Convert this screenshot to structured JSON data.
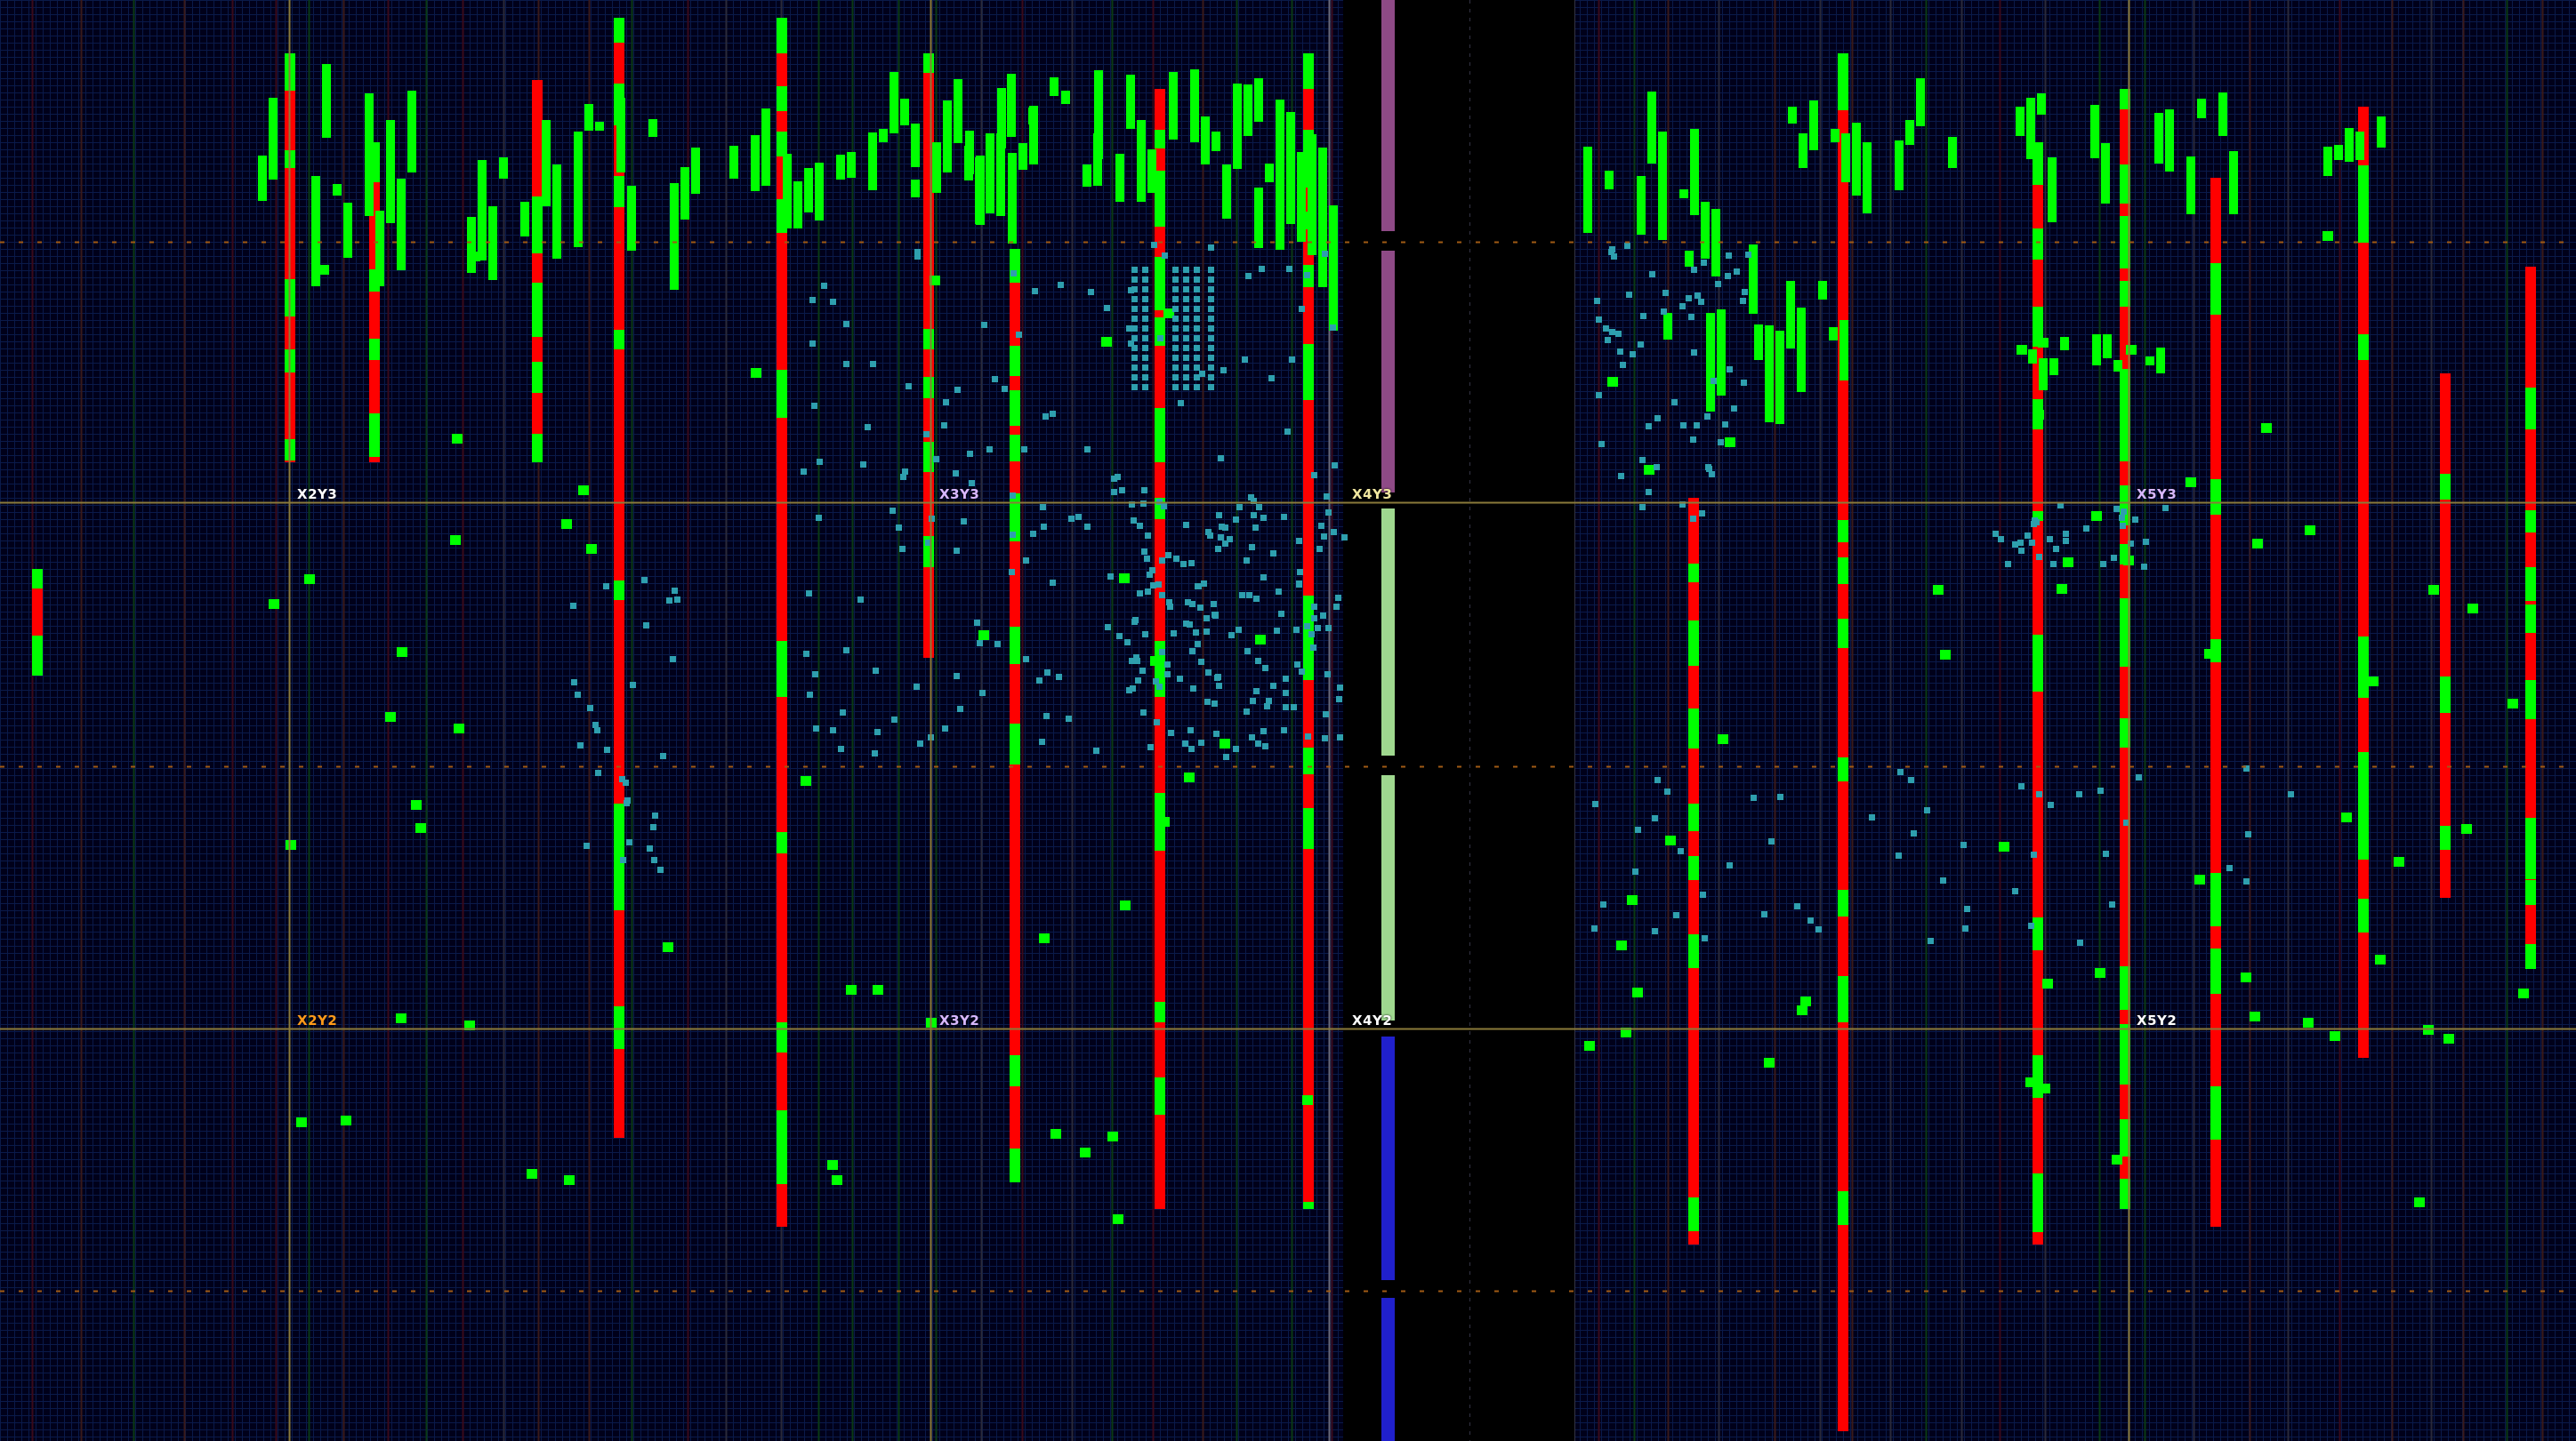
{
  "view": {
    "title": "",
    "colors": {
      "background": "#00001a",
      "grid_minor": "#0a1a4a",
      "grid_major": "#14245e",
      "region_line_gold": "#8a7a3a",
      "region_line_orange": "#a05a14",
      "placed_logic": "#00ff00",
      "critical_column": "#ff0000",
      "placed_ff": "#2e9fae",
      "io_purple": "#8e4a86",
      "io_light_green": "#9fd88f",
      "io_blue": "#2020cc",
      "label_white": "#ffffff",
      "label_orange": "#ff9a1a",
      "label_lavender": "#d8b8ff",
      "label_yellow": "#f2e8a0"
    }
  },
  "clock_regions": [
    {
      "id": "x2y3",
      "label": "X2Y3",
      "color": "#ffffff"
    },
    {
      "id": "x3y3",
      "label": "X3Y3",
      "color": "#d8b8ff"
    },
    {
      "id": "x4y3",
      "label": "X4Y3",
      "color": "#f2e8a0"
    },
    {
      "id": "x5y3",
      "label": "X5Y3",
      "color": "#d8b8ff"
    },
    {
      "id": "x2y2",
      "label": "X2Y2",
      "color": "#ff9a1a"
    },
    {
      "id": "x3y2",
      "label": "X3Y2",
      "color": "#d8b8ff"
    },
    {
      "id": "x4y2",
      "label": "X4Y2",
      "color": "#ffffff"
    },
    {
      "id": "x5y2",
      "label": "X5Y2",
      "color": "#ffffff"
    }
  ]
}
